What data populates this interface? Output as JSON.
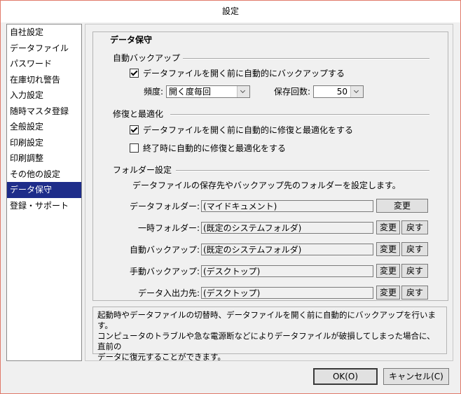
{
  "window": {
    "title": "設定"
  },
  "sidebar": {
    "items": [
      {
        "label": "自社設定"
      },
      {
        "label": "データファイル"
      },
      {
        "label": "パスワード"
      },
      {
        "label": "在庫切れ警告"
      },
      {
        "label": "入力設定"
      },
      {
        "label": "随時マスタ登録"
      },
      {
        "label": "全般設定"
      },
      {
        "label": "印刷設定"
      },
      {
        "label": "印刷調整"
      },
      {
        "label": "その他の設定"
      },
      {
        "label": "データ保守",
        "selected": true
      },
      {
        "label": "登録・サポート"
      }
    ]
  },
  "panel": {
    "title": "データ保守",
    "auto_backup": {
      "section": "自動バックアップ",
      "checkbox_label": "データファイルを開く前に自動的にバックアップする",
      "checkbox_checked": true,
      "frequency_label": "頻度:",
      "frequency_value": "開く度毎回",
      "count_label": "保存回数:",
      "count_value": "50"
    },
    "repair": {
      "section": "修復と最適化",
      "on_open_label": "データファイルを開く前に自動的に修復と最適化をする",
      "on_open_checked": true,
      "on_exit_label": "終了時に自動的に修復と最適化をする",
      "on_exit_checked": false
    },
    "folders": {
      "section": "フォルダー設定",
      "description": "データファイルの保存先やバックアップ先のフォルダーを設定します。",
      "change_label": "変更",
      "reset_label": "戻す",
      "rows": [
        {
          "label": "データフォルダー:",
          "path": "(マイドキュメント)"
        },
        {
          "label": "一時フォルダー:",
          "path": "(既定のシステムフォルダ)"
        },
        {
          "label": "自動バックアップ:",
          "path": "(既定のシステムフォルダ)"
        },
        {
          "label": "手動バックアップ:",
          "path": "(デスクトップ)"
        },
        {
          "label": "データ入出力先:",
          "path": "(デスクトップ)"
        }
      ]
    }
  },
  "info": {
    "line1": "起動時やデータファイルの切替時、データファイルを開く前に自動的にバックアップを行います。",
    "line2": "コンピュータのトラブルや急な電源断などによりデータファイルが破損してしまった場合に、直前の",
    "line3": "データに復元することができます。"
  },
  "buttons": {
    "ok": "OK(O)",
    "cancel": "キャンセル(C)"
  }
}
